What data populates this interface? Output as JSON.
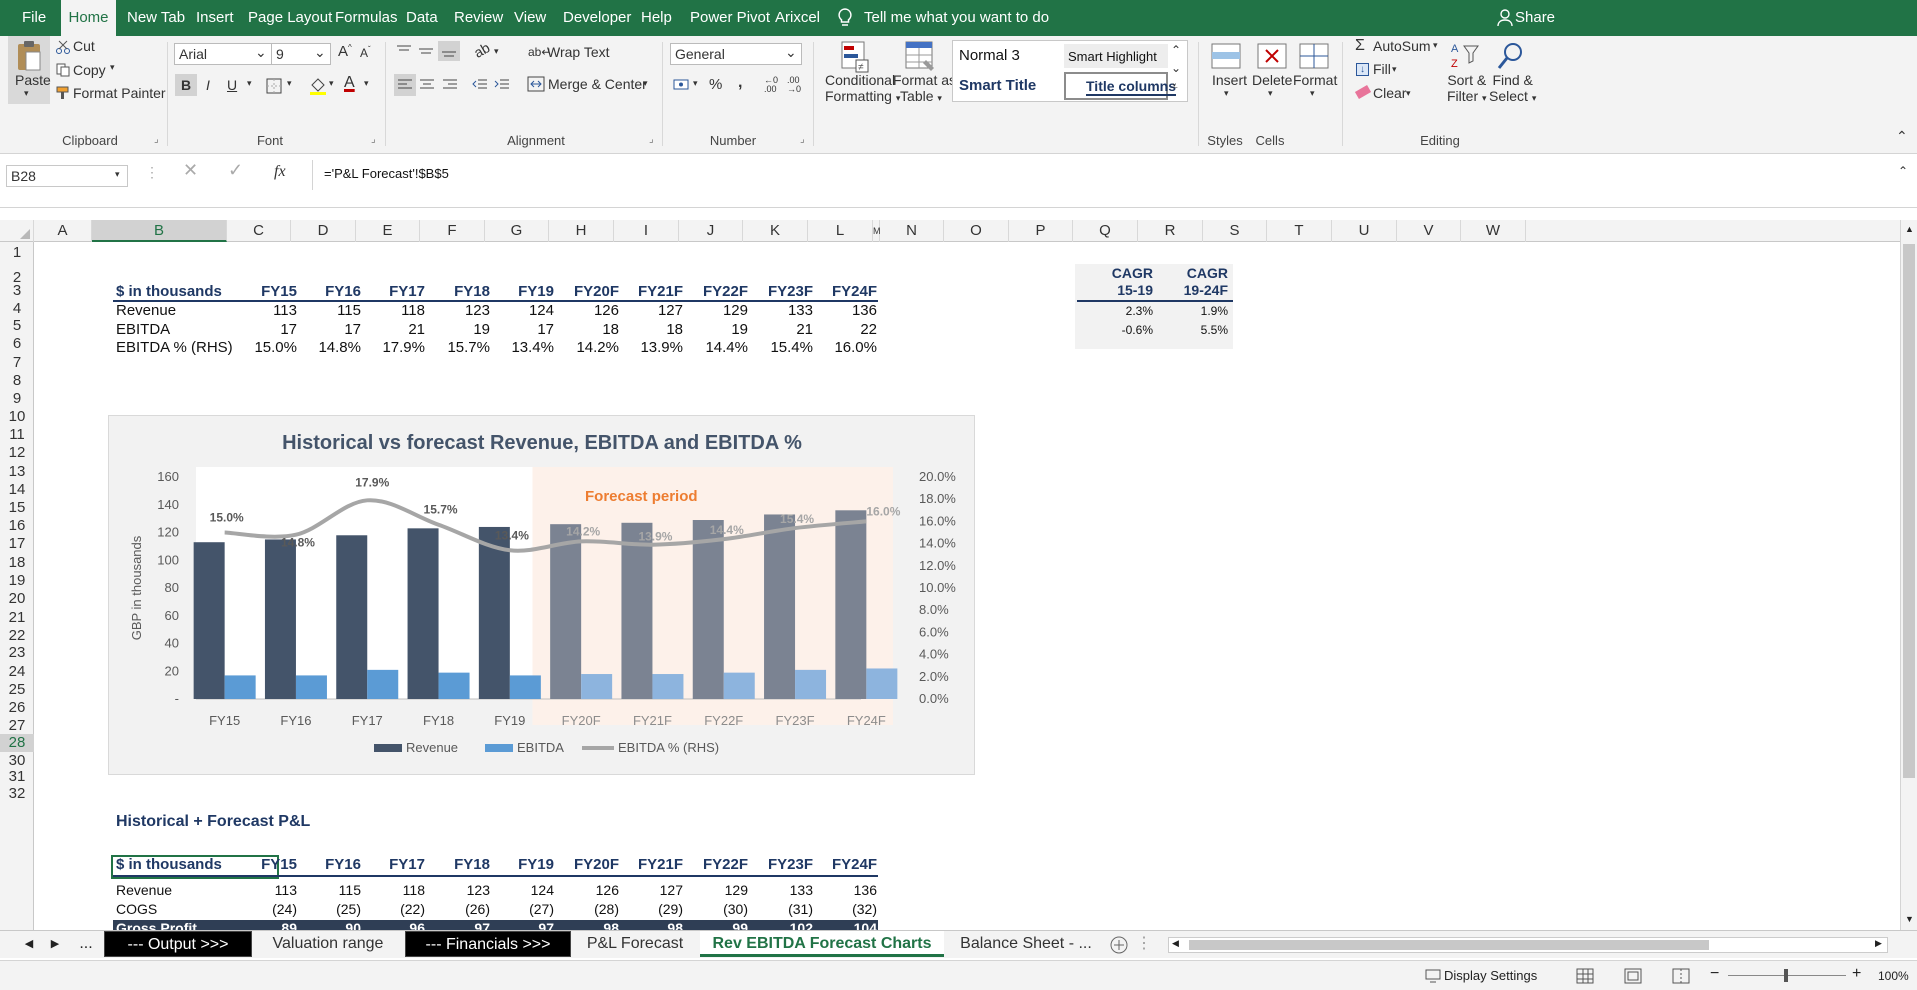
{
  "menu": {
    "tabs": [
      "File",
      "Home",
      "New Tab",
      "Insert",
      "Page Layout",
      "Formulas",
      "Data",
      "Review",
      "View",
      "Developer",
      "Help",
      "Power Pivot",
      "Arixcel"
    ],
    "tell_me": "Tell me what you want to do",
    "share": "Share"
  },
  "ribbon": {
    "clipboard": {
      "paste": "Paste",
      "cut": "Cut",
      "copy": "Copy",
      "format_painter": "Format Painter",
      "label": "Clipboard"
    },
    "font": {
      "name": "Arial",
      "size": "9",
      "bold": "B",
      "italic": "I",
      "underline": "U",
      "label": "Font"
    },
    "alignment": {
      "wrap_text": "Wrap Text",
      "merge_center": "Merge & Center",
      "label": "Alignment"
    },
    "number": {
      "format": "General",
      "percent": "%",
      "comma": ",",
      "label": "Number"
    },
    "styles": {
      "conditional": "Conditional",
      "conditional2": "Formatting",
      "format_as": "Format as",
      "format_as2": "Table",
      "normal3": "Normal 3",
      "smart_highlight": "Smart Highlight",
      "smart_title": "Smart Title",
      "title_columns": "Title columns",
      "label": "Styles"
    },
    "cells": {
      "insert": "Insert",
      "delete": "Delete",
      "format": "Format",
      "label": "Cells"
    },
    "editing": {
      "autosum": "AutoSum",
      "fill": "Fill",
      "clear": "Clear",
      "sort": "Sort &",
      "sort2": "Filter",
      "find": "Find &",
      "find2": "Select",
      "label": "Editing"
    }
  },
  "formula_bar": {
    "name_box": "B28",
    "fx": "fx",
    "formula": "='P&L Forecast'!$B$5"
  },
  "columns": [
    "A",
    "B",
    "C",
    "D",
    "E",
    "F",
    "G",
    "H",
    "I",
    "J",
    "K",
    "L",
    "M",
    "N",
    "O",
    "P",
    "Q",
    "R",
    "S",
    "T",
    "U",
    "V",
    "W"
  ],
  "rows": [
    "1",
    "2",
    "3",
    "4",
    "5",
    "6",
    "7",
    "8",
    "9",
    "10",
    "11",
    "12",
    "13",
    "14",
    "15",
    "16",
    "17",
    "18",
    "19",
    "20",
    "21",
    "22",
    "23",
    "24",
    "25",
    "26",
    "27",
    "28",
    "30",
    "31",
    "32"
  ],
  "summary_table": {
    "header": "$ in thousands",
    "years": [
      "FY15",
      "FY16",
      "FY17",
      "FY18",
      "FY19",
      "FY20F",
      "FY21F",
      "FY22F",
      "FY23F",
      "FY24F"
    ],
    "cagr_headers": [
      [
        "CAGR",
        "15-19"
      ],
      [
        "CAGR",
        "19-24F"
      ]
    ],
    "rows": [
      {
        "label": "Revenue",
        "values": [
          "113",
          "115",
          "118",
          "123",
          "124",
          "126",
          "127",
          "129",
          "133",
          "136"
        ],
        "cagr": [
          "2.3%",
          "1.9%"
        ]
      },
      {
        "label": "EBITDA",
        "values": [
          "17",
          "17",
          "21",
          "19",
          "17",
          "18",
          "18",
          "19",
          "21",
          "22"
        ],
        "cagr": [
          "-0.6%",
          "5.5%"
        ]
      },
      {
        "label": "EBITDA % (RHS)",
        "values": [
          "15.0%",
          "14.8%",
          "17.9%",
          "15.7%",
          "13.4%",
          "14.2%",
          "13.9%",
          "14.4%",
          "15.4%",
          "16.0%"
        ],
        "cagr": []
      }
    ]
  },
  "chart_data": {
    "type": "bar",
    "title": "Historical vs forecast Revenue, EBITDA and EBITDA %",
    "ylabel": "GBP in thousands",
    "annotation": "Forecast period",
    "categories": [
      "FY15",
      "FY16",
      "FY17",
      "FY18",
      "FY19",
      "FY20F",
      "FY21F",
      "FY22F",
      "FY23F",
      "FY24F"
    ],
    "ylim": [
      0,
      160
    ],
    "y_ticks": [
      "-",
      "20",
      "40",
      "60",
      "80",
      "100",
      "120",
      "140",
      "160"
    ],
    "y2lim": [
      0,
      0.2
    ],
    "y2_ticks": [
      "0.0%",
      "2.0%",
      "4.0%",
      "6.0%",
      "8.0%",
      "10.0%",
      "12.0%",
      "14.0%",
      "16.0%",
      "18.0%",
      "20.0%"
    ],
    "series": [
      {
        "name": "Revenue",
        "kind": "bar",
        "values": [
          113,
          115,
          118,
          123,
          124,
          126,
          127,
          129,
          133,
          136
        ]
      },
      {
        "name": "EBITDA",
        "kind": "bar",
        "values": [
          17,
          17,
          21,
          19,
          17,
          18,
          18,
          19,
          21,
          22
        ]
      },
      {
        "name": "EBITDA % (RHS)",
        "kind": "line",
        "axis": "right",
        "values": [
          0.15,
          0.148,
          0.179,
          0.157,
          0.134,
          0.142,
          0.139,
          0.144,
          0.154,
          0.16
        ],
        "labels": [
          "15.0%",
          "14.8%",
          "17.9%",
          "15.7%",
          "13.4%",
          "14.2%",
          "13.9%",
          "14.4%",
          "15.4%",
          "16.0%"
        ]
      }
    ],
    "forecast_start_index": 5,
    "colors": {
      "revenue_hist": "#44546a",
      "revenue_fc": "#7b8392",
      "ebitda_hist": "#5b9bd5",
      "ebitda_fc": "#8db4de",
      "line": "#a6a6a6",
      "forecast_bg": "#fdf1ea",
      "forecast_text": "#ed7d31"
    },
    "legend": "bottom",
    "grid": false
  },
  "pl_section": {
    "title": "Historical + Forecast P&L",
    "header": "$ in thousands",
    "rows": [
      {
        "label": "Revenue",
        "values": [
          "113",
          "115",
          "118",
          "123",
          "124",
          "126",
          "127",
          "129",
          "133",
          "136"
        ]
      },
      {
        "label": "COGS",
        "values": [
          "(24)",
          "(25)",
          "(22)",
          "(26)",
          "(27)",
          "(28)",
          "(29)",
          "(30)",
          "(31)",
          "(32)"
        ]
      },
      {
        "label": "Gross Profit",
        "values": [
          "89",
          "90",
          "96",
          "97",
          "97",
          "98",
          "98",
          "99",
          "102",
          "104"
        ]
      }
    ]
  },
  "sheet_tabs": [
    {
      "label": "--- Output >>>",
      "style": "dark"
    },
    {
      "label": "Valuation range",
      "style": "normal"
    },
    {
      "label": "--- Financials >>>",
      "style": "dark"
    },
    {
      "label": "P&L Forecast",
      "style": "normal"
    },
    {
      "label": "Rev EBITDA Forecast Charts",
      "style": "active"
    },
    {
      "label": "Balance Sheet - ...",
      "style": "normal"
    }
  ],
  "status": {
    "display_settings": "Display Settings",
    "zoom": "100%"
  },
  "colors": {
    "excel_green": "#217346",
    "header_blue": "#1f3864",
    "dark_tab": "#000000"
  }
}
